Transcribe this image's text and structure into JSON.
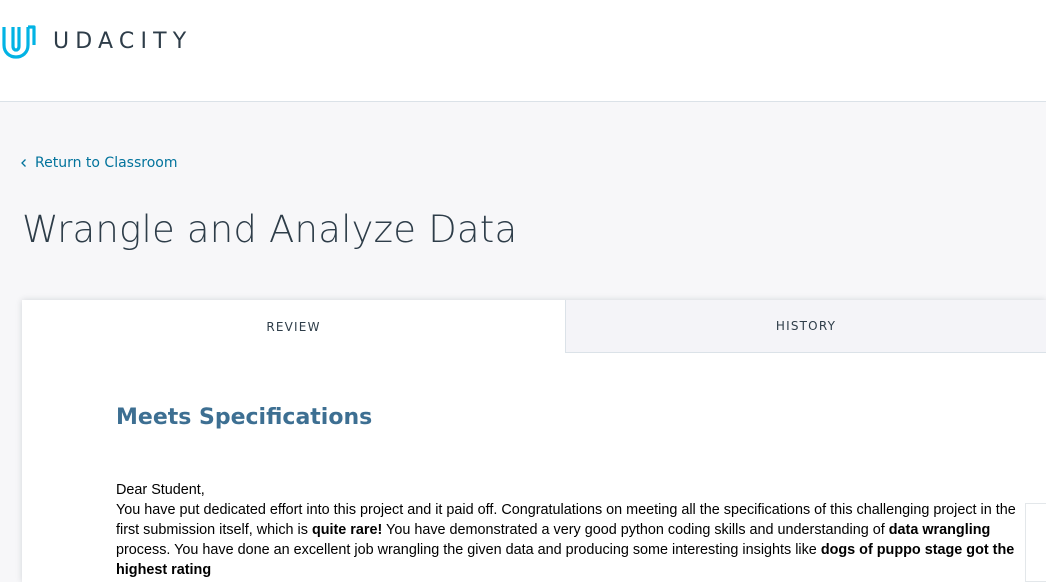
{
  "brand": {
    "name": "UDACITY",
    "logo_icon": "udacity-logo-icon",
    "logo_color": "#02b3e4"
  },
  "navigation": {
    "back_label": "Return to Classroom",
    "back_icon": "chevron-left-icon"
  },
  "page": {
    "title": "Wrangle and Analyze Data"
  },
  "tabs": [
    {
      "label": "REVIEW",
      "active": true
    },
    {
      "label": "HISTORY",
      "active": false
    }
  ],
  "review": {
    "status": "Meets Specifications",
    "greeting": "Dear Student,",
    "segments": [
      {
        "text": "You have put dedicated effort into this project and it paid off. Congratulations on meeting all the specifications of this challenging project in the first submission itself, which is ",
        "bold": false
      },
      {
        "text": "quite rare!",
        "bold": true
      },
      {
        "text": " You have demonstrated a very good python coding skills and understanding of ",
        "bold": false
      },
      {
        "text": "data wrangling",
        "bold": true
      },
      {
        "text": " process. You have done an excellent job wrangling the given data and producing some interesting insights like ",
        "bold": false
      },
      {
        "text": "dogs of puppo stage got the highest rating",
        "bold": true
      }
    ]
  },
  "colors": {
    "link": "#02739c",
    "status": "#3d6f92",
    "text": "#2e3d49",
    "page_bg": "#f7f7f9"
  }
}
